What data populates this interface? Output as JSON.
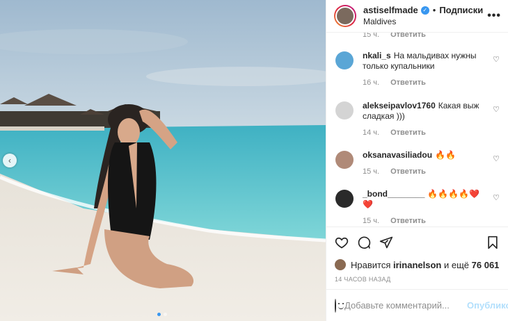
{
  "post": {
    "username": "astiselfmade",
    "follow_label": "Подписки",
    "separator": "•",
    "location": "Maldives",
    "more_label": "•••"
  },
  "partial_comment": {
    "time": "15 ч.",
    "reply": "Ответить"
  },
  "comments": [
    {
      "user": "nkali_s",
      "text": "На мальдивах нужны только купальники",
      "time": "16 ч.",
      "reply": "Ответить",
      "avatar_color": "#5aa6d6"
    },
    {
      "user": "alekseipavlov1760",
      "text": "Какая выж сладкая )))",
      "time": "14 ч.",
      "reply": "Ответить",
      "avatar_color": "#d4d4d4"
    },
    {
      "user": "oksanavasiliadou",
      "text": "🔥🔥",
      "time": "15 ч.",
      "reply": "Ответить",
      "avatar_color": "#b08a78"
    },
    {
      "user": "_bond________",
      "text": "🔥🔥🔥🔥❤️❤️",
      "time": "15 ч.",
      "reply": "Ответить",
      "avatar_color": "#2a2a2a"
    }
  ],
  "likes": {
    "prefix": "Нравится",
    "user": "irinanelson",
    "middle": "и ещё",
    "count": "76 061"
  },
  "time_ago": "14 ЧАСОВ НАЗАД",
  "composer": {
    "placeholder": "Добавьте комментарий...",
    "publish_label": "Опубликовать"
  },
  "colors": {
    "accent": "#3897f0",
    "publish_disabled": "#b2dffc",
    "heart_icon": "heart-outline",
    "comment_icon": "speech-bubble",
    "share_icon": "paper-plane",
    "save_icon": "bookmark"
  }
}
